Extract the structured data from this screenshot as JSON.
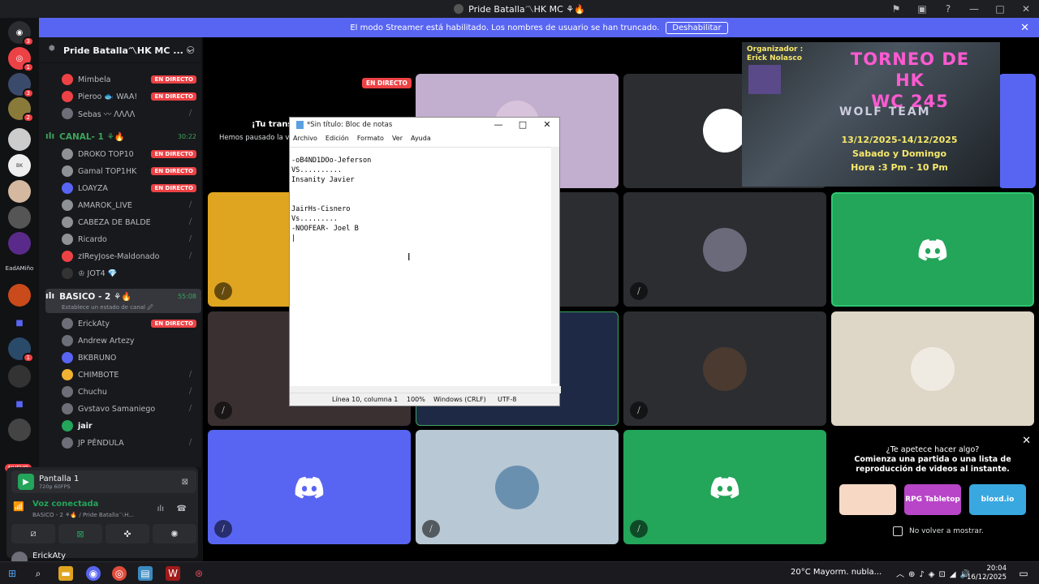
{
  "window": {
    "title": "Pride Batalla〽HK MC ⚘🔥"
  },
  "banner": {
    "text": "El modo Streamer está habilitado. Los nombres de usuario se han truncado.",
    "button": "Deshabilitar"
  },
  "servers": {
    "badges": [
      "3",
      "1",
      "3",
      "2",
      "1"
    ],
    "label_ead": "EadAMiño",
    "nuevo": "NUEVO"
  },
  "channels": {
    "server_name": "Pride Batalla〽HK MC ...",
    "live_label": "EN DIRECTO",
    "list_top": [
      {
        "name": "Mimbela",
        "live": true,
        "color": "#ed4245"
      },
      {
        "name": "Pieroo 🐟 WAA!",
        "live": true,
        "color": "#ed4245"
      },
      {
        "name": "Sebas 〰 ᐱᐱᐱᐱ",
        "live": false,
        "color": "#6d6f78"
      }
    ],
    "canal": {
      "name": "CANAL- 1 ⚘🔥",
      "time": "30:22"
    },
    "canal_users": [
      {
        "name": "DROKO TOP10",
        "live": true,
        "color": "#8e9297"
      },
      {
        "name": "Gamal TOP1HK",
        "live": true,
        "color": "#8e9297"
      },
      {
        "name": "LOAYZA",
        "live": true,
        "color": "#5865f2"
      },
      {
        "name": "AMAROK_LIVE",
        "live": false,
        "color": "#8e9297"
      },
      {
        "name": "CABEZA DE BALDE",
        "live": false,
        "color": "#8e9297"
      },
      {
        "name": "Ricardo",
        "live": false,
        "color": "#8e9297"
      },
      {
        "name": "zIReyJose-Maldonado",
        "live": false,
        "color": "#ed4245"
      },
      {
        "name": "♔ JOT4 💎",
        "live": false,
        "color": "#333"
      }
    ],
    "basico": {
      "name": "BASICO - 2 ⚘🔥",
      "time": "55:08",
      "status": "Establece un estado de canal 🖉"
    },
    "basico_users": [
      {
        "name": "ErickAty",
        "live": true,
        "color": "#6d6f78"
      },
      {
        "name": "Andrew Artezy",
        "live": false,
        "color": "#6d6f78"
      },
      {
        "name": "BKBRUNO",
        "live": false,
        "color": "#5865f2"
      },
      {
        "name": "CHIMBOTE",
        "live": false,
        "color": "#f0b232"
      },
      {
        "name": "Chuchu",
        "live": false,
        "color": "#6d6f78"
      },
      {
        "name": "Gvstavo Samaniego",
        "live": false,
        "color": "#6d6f78"
      },
      {
        "name": "jair",
        "live": false,
        "color": "#23a55a"
      },
      {
        "name": "JP PÉNDULA",
        "live": false,
        "color": "#6d6f78"
      }
    ]
  },
  "panel": {
    "pantalla": "Pantalla 1",
    "quality": "720p 60FPS",
    "voice_title": "Voz conectada",
    "voice_sub": "BASICO - 2 ⚘🔥 / Pride Batalla〽H...",
    "user": "ErickAty"
  },
  "stage": {
    "live_label": "EN DIRECTO",
    "share_title": "¡Tu transm",
    "share_sub": "Hemos pausado la vi"
  },
  "ad": {
    "organizer": "Organizador :",
    "organizer_name": "Erick Nolasco",
    "title1": "TORNEO DE HK",
    "title2": "WC 245",
    "logo": "WOLF TEAM",
    "dates": "13/12/2025-14/12/2025",
    "days": "Sabado y Domingo",
    "hour": "Hora :3 Pm - 10 Pm"
  },
  "notepad": {
    "title": "*Sin título: Bloc de notas",
    "menu": [
      "Archivo",
      "Edición",
      "Formato",
      "Ver",
      "Ayuda"
    ],
    "content": "-oB4ND1DOo-Jeferson\nVS..........\nInsanity Javier\n\n\nJairHs-Cisnero\nVs.........\n-NOOFEAR- Joel B\n|",
    "status_pos": "Línea 10, columna 1",
    "status_zoom": "100%",
    "status_eol": "Windows (CRLF)",
    "status_enc": "UTF-8"
  },
  "activity": {
    "question": "¿Te apetece hacer algo?",
    "desc": "Comienza una partida o una lista de reproducción de videos al instante.",
    "cards": [
      "",
      "RPG Tabletop",
      "bloxd.io"
    ],
    "dont_show": "No volver a mostrar."
  },
  "taskbar": {
    "weather": "20°C  Mayorm. nubla...",
    "time": "20:04",
    "date": "16/12/2025"
  }
}
